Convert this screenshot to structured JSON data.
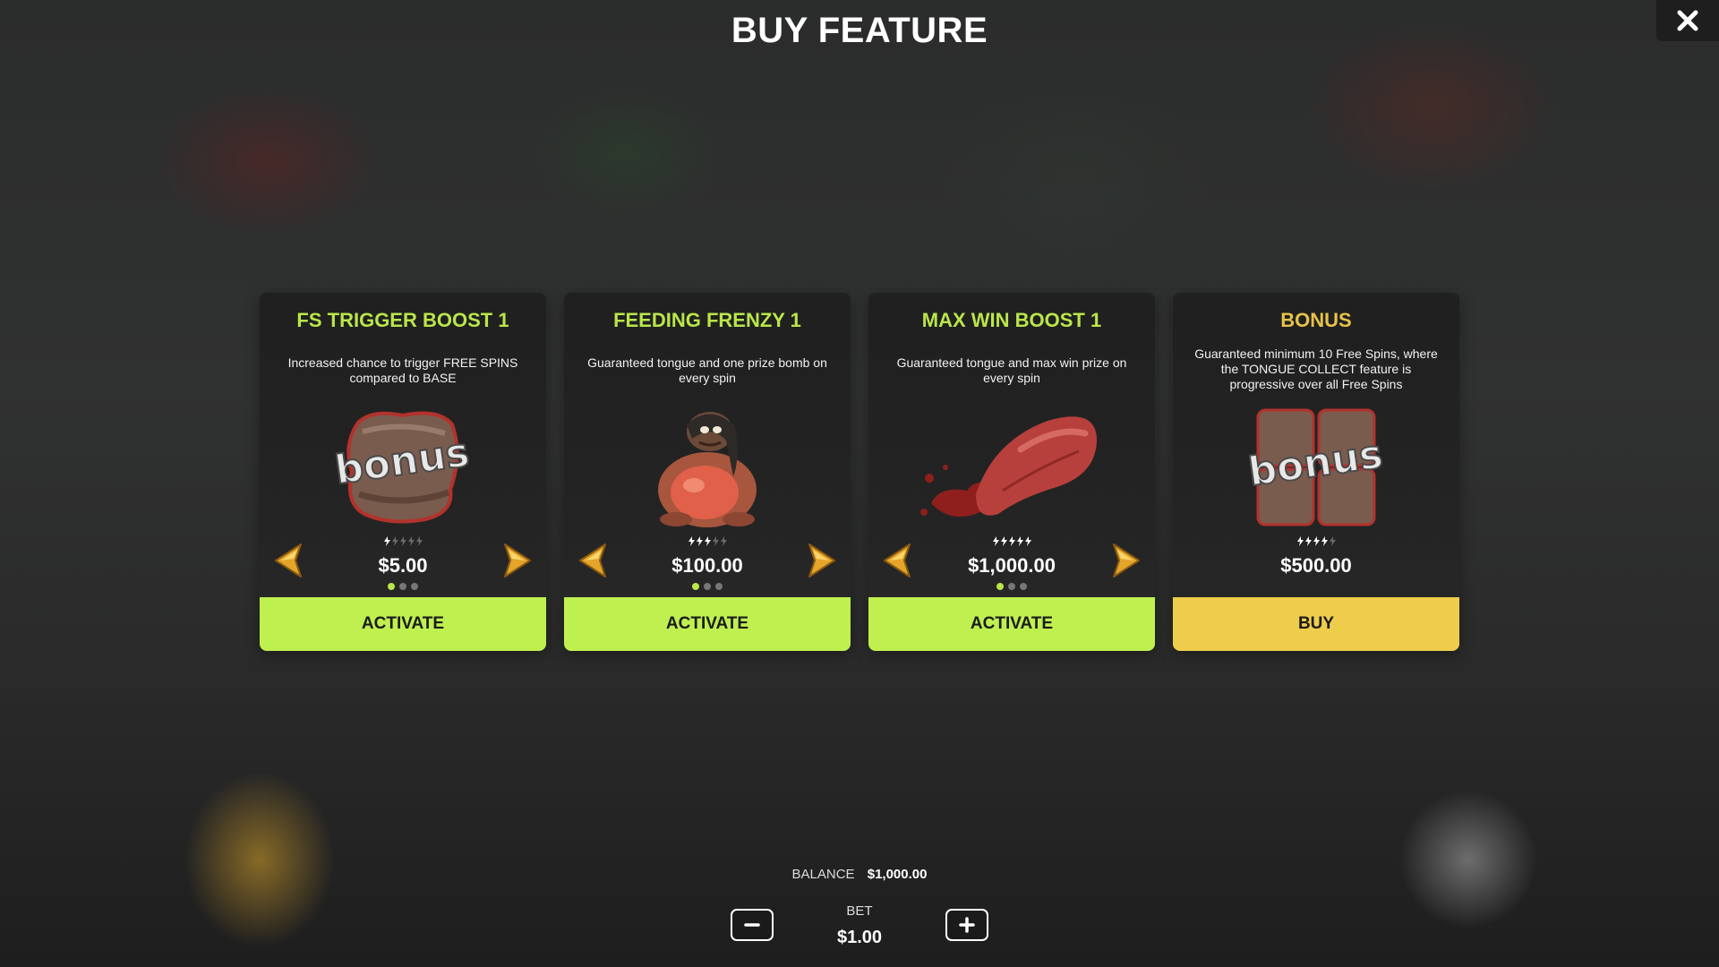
{
  "header": {
    "title": "BUY FEATURE",
    "close_icon": "close-icon"
  },
  "colors": {
    "accent_green": "#bff04f",
    "accent_gold": "#efcd4c",
    "title_green": "#b9e64a",
    "title_gold": "#e8c24a"
  },
  "cards": [
    {
      "title": "FS TRIGGER BOOST 1",
      "description": "Increased chance to trigger FREE SPINS compared to BASE",
      "image": "bonus-scatter-icon",
      "price": "$5.00",
      "rating_level": 1,
      "rating_max": 5,
      "page_index": 1,
      "page_count": 3,
      "button_label": "ACTIVATE",
      "has_arrows": true
    },
    {
      "title": "FEEDING FRENZY 1",
      "description": "Guaranteed tongue and one prize bomb on every spin",
      "image": "frog-character-icon",
      "price": "$100.00",
      "rating_level": 3,
      "rating_max": 5,
      "page_index": 1,
      "page_count": 3,
      "button_label": "ACTIVATE",
      "has_arrows": true
    },
    {
      "title": "MAX WIN BOOST 1",
      "description": "Guaranteed tongue and max win prize on every spin",
      "image": "tongue-splash-icon",
      "price": "$1,000.00",
      "rating_level": 5,
      "rating_max": 5,
      "page_index": 1,
      "page_count": 3,
      "button_label": "ACTIVATE",
      "has_arrows": true
    },
    {
      "title": "BONUS",
      "description": "Guaranteed minimum 10 Free Spins, where the TONGUE COLLECT feature is progressive over all Free Spins",
      "image": "bonus-multi-scatter-icon",
      "price": "$500.00",
      "rating_level": 4,
      "rating_max": 5,
      "button_label": "BUY",
      "has_arrows": false
    }
  ],
  "footer": {
    "balance_label": "BALANCE",
    "balance_value": "$1,000.00",
    "bet_label": "BET",
    "bet_value": "$1.00",
    "minus_icon": "minus-icon",
    "plus_icon": "plus-icon"
  }
}
